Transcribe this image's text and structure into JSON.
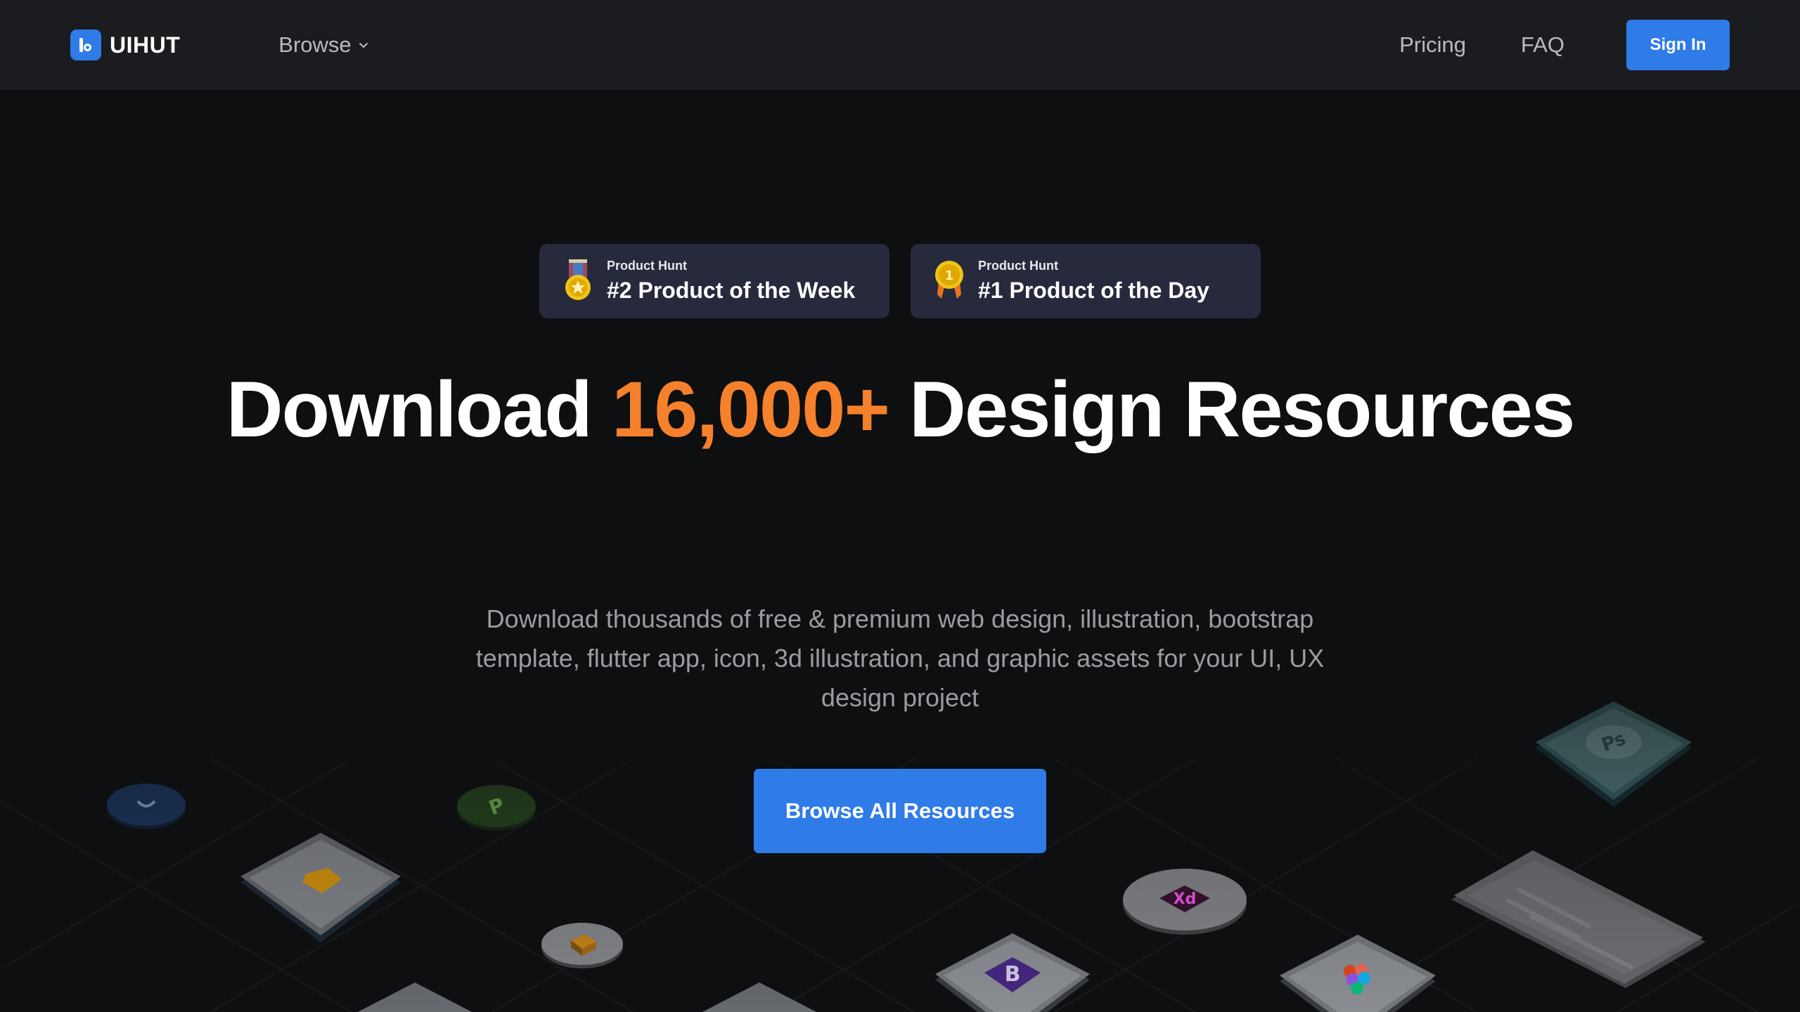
{
  "header": {
    "logo_text": "UIHUT",
    "browse_label": "Browse",
    "nav": {
      "pricing_label": "Pricing",
      "faq_label": "FAQ",
      "signin_label": "Sign In"
    }
  },
  "badges": [
    {
      "source": "Product Hunt",
      "title": "#2 Product of the Week",
      "icon": "medal-icon"
    },
    {
      "source": "Product Hunt",
      "title": "#1 Product of the Day",
      "icon": "ribbon-medal-icon"
    }
  ],
  "hero": {
    "headline_before": "Download ",
    "headline_accent": "16,000+",
    "headline_after": " Design Resources",
    "subtext": "Download thousands of free & premium web design, illustration, bootstrap template, flutter app, icon, 3d illustration, and graphic assets for your UI, UX design project",
    "cta_label": "Browse All Resources"
  },
  "decorative_icons": [
    "sketch-icon",
    "xd-icon",
    "photoshop-icon",
    "bootstrap-icon",
    "figma-icon",
    "box-icon",
    "phone-mockup"
  ],
  "colors": {
    "header_bg": "#1b1c1f",
    "page_bg": "#0e0f11",
    "primary_blue": "#2f7be8",
    "accent_orange": "#f5812c",
    "badge_bg": "#272a3c"
  }
}
